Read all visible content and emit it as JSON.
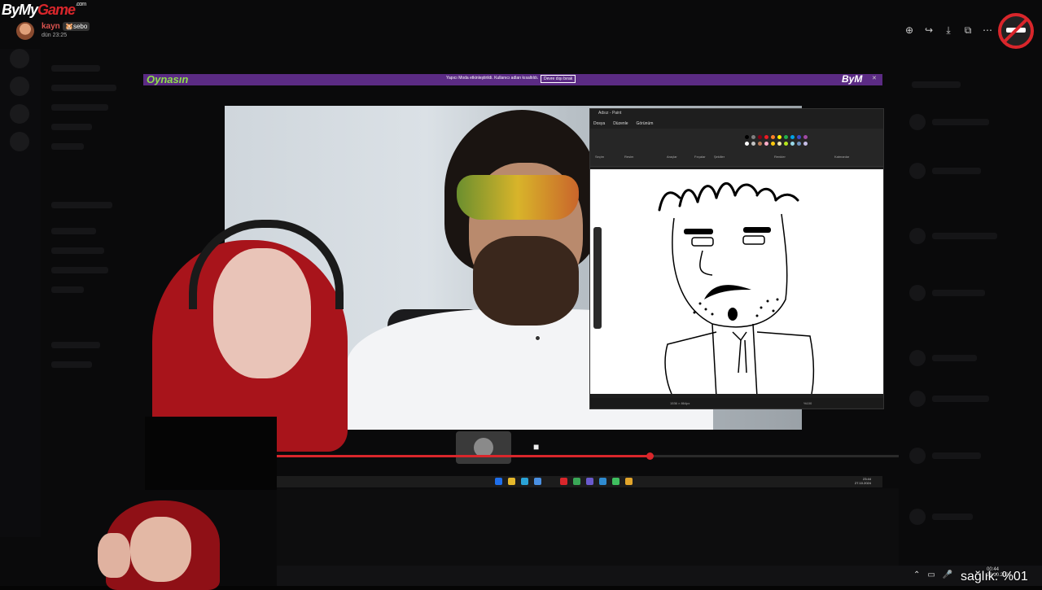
{
  "watermark": {
    "by": "By",
    "my": "My",
    "game": "Game",
    "sub": ".com"
  },
  "chat_message": {
    "username": "kayn",
    "tag": "🐹sebo",
    "time": "dün 23:25"
  },
  "toolbar": {
    "zoom_icon": "zoom-in-icon",
    "share_icon": "share-arrow-icon",
    "download_icon": "download-icon",
    "open_icon": "open-external-icon",
    "more_icon": "more-dots-icon"
  },
  "banner": {
    "brand": "Oynasın",
    "message": "Yapıcı Moda etkinleştirildi. Kullanıcı adları kısaltıldı.",
    "button": "Devre dışı bırak",
    "logo": "ByM"
  },
  "paint": {
    "title": "Adsız - Paint",
    "menu": [
      "Dosya",
      "Düzenle",
      "Görünüm"
    ],
    "ribbon_labels": [
      "Seçim",
      "Resim",
      "Araçlar",
      "Fırçalar",
      "Şekiller",
      "Renkler",
      "Katmanlar"
    ],
    "status_size": "1536 × 864px",
    "zoom": "%100",
    "swatch_colors": [
      "#000000",
      "#7f7f7f",
      "#880015",
      "#ed1c24",
      "#ff7f27",
      "#fff200",
      "#22b14c",
      "#00a2e8",
      "#3f48cc",
      "#a349a4",
      "#ffffff",
      "#c3c3c3",
      "#b97a57",
      "#ffaec9",
      "#ffc90e",
      "#efe4b0",
      "#b5e61d",
      "#99d9ea",
      "#7092be",
      "#c8bfe7"
    ]
  },
  "player": {
    "progress": 0.6
  },
  "taskbar": {
    "time": "23:44",
    "date": "27.10.2024",
    "app_colors": [
      "#1f6feb",
      "#e5b82b",
      "#2aa3d6",
      "#4a90e2",
      "#1c1c1c",
      "#d9262b",
      "#3aa757",
      "#6a5acd",
      "#2f8bd0",
      "#3fbf5f",
      "#e2a52b"
    ]
  },
  "hud": {
    "health": "sağlık: %01",
    "clock_time": "00:44",
    "clock_date": "28.10.2024"
  }
}
